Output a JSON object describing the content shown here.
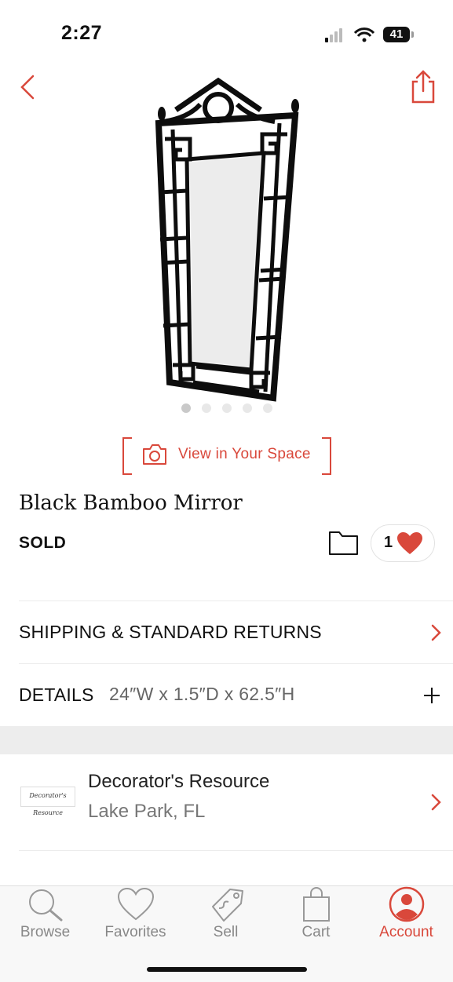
{
  "status_bar": {
    "time": "2:27",
    "battery": "41"
  },
  "colors": {
    "accent": "#d9483b",
    "text": "#111111",
    "muted": "#777777",
    "divider": "#ececec"
  },
  "nav": {
    "back_icon": "chevron-left-icon",
    "share_icon": "share-icon"
  },
  "gallery": {
    "image_count": 5,
    "active_index": 0
  },
  "view_in_space": {
    "label": "View in Your Space"
  },
  "product": {
    "title": "Black Bamboo Mirror",
    "status": "SOLD",
    "favorite_count": "1"
  },
  "rows": {
    "shipping_label": "SHIPPING & STANDARD RETURNS",
    "details_label": "DETAILS",
    "details_value": "24″W x 1.5″D x 62.5″H"
  },
  "seller": {
    "logo_text": "Decorator's Resource",
    "name": "Decorator's Resource",
    "location": "Lake Park, FL"
  },
  "tabs": [
    {
      "label": "Browse",
      "icon": "search-icon",
      "active": false
    },
    {
      "label": "Favorites",
      "icon": "heart-icon",
      "active": false
    },
    {
      "label": "Sell",
      "icon": "tag-icon",
      "active": false
    },
    {
      "label": "Cart",
      "icon": "shopping-bag-icon",
      "active": false
    },
    {
      "label": "Account",
      "icon": "user-icon",
      "active": true
    }
  ]
}
